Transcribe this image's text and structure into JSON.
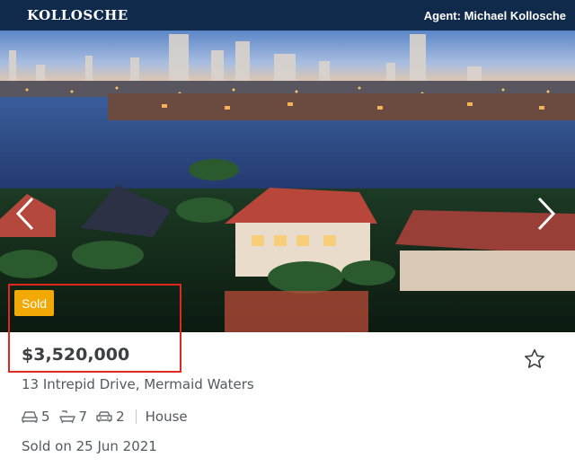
{
  "header": {
    "brand": "Kollosche",
    "agent_label": "Agent: Michael Kollosche"
  },
  "listing": {
    "badge": "Sold",
    "price": "$3,520,000",
    "address": "13 Intrepid Drive, Mermaid Waters",
    "features": {
      "bedrooms": "5",
      "bathrooms": "7",
      "car_spaces": "2",
      "property_type": "House"
    },
    "sold_date": "Sold on 25 Jun 2021"
  },
  "icons": {
    "prev": "chevron-left-icon",
    "next": "chevron-right-icon",
    "favourite": "star-outline-icon",
    "bed": "bed-icon",
    "bath": "bath-icon",
    "car": "car-icon"
  },
  "colors": {
    "header_bg": "#0f2a4b",
    "badge": "#f2a805",
    "highlight": "#e0281e",
    "text": "#3d3f44"
  }
}
